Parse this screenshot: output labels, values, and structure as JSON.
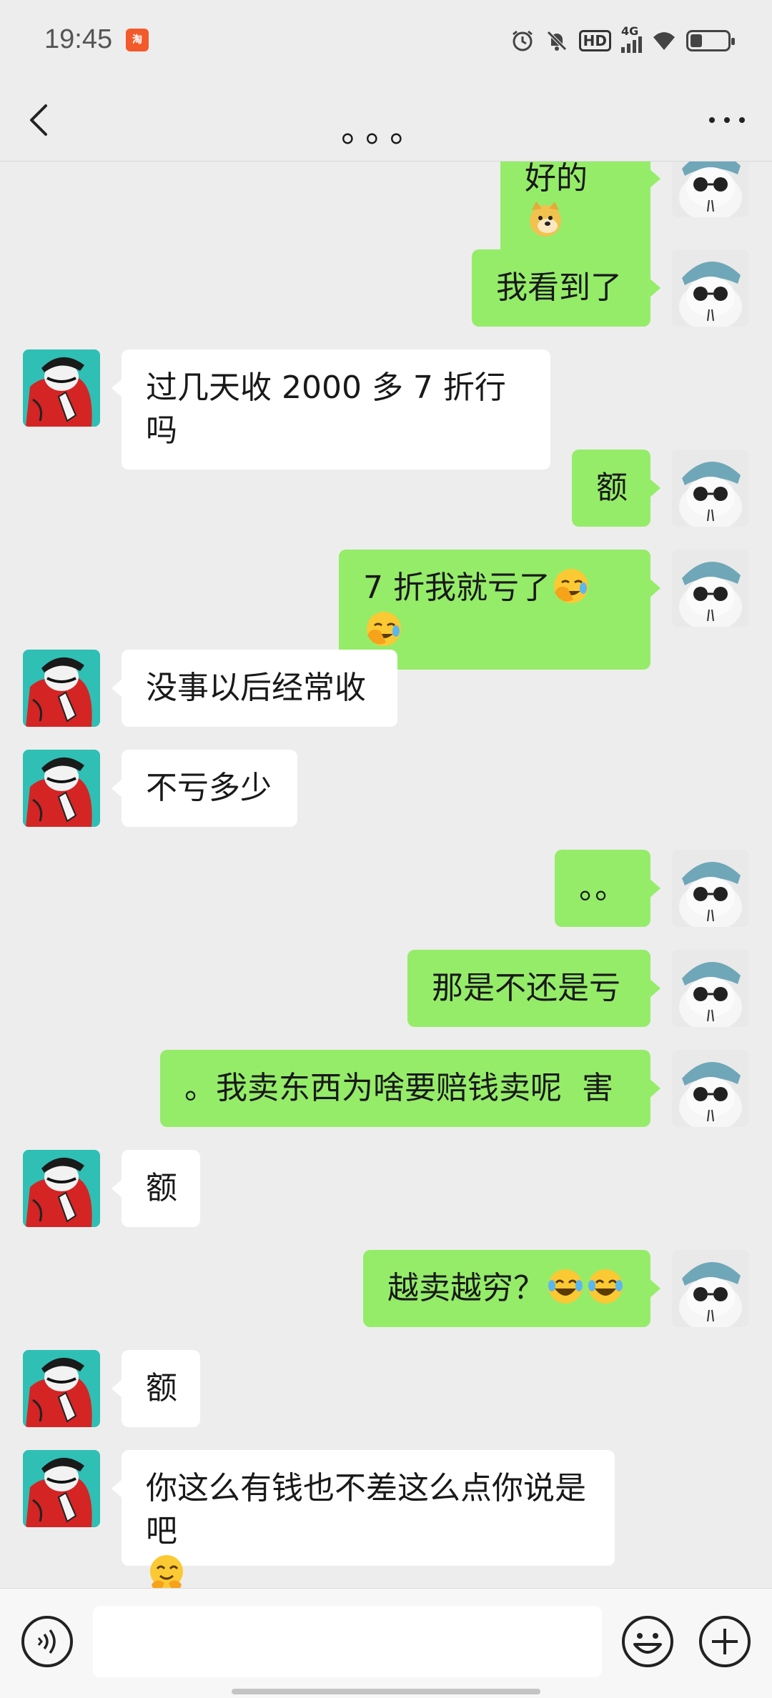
{
  "status_bar": {
    "time": "19:45",
    "hd_label": "HD",
    "network_label": "4G",
    "icons": [
      "alarm-icon",
      "mute-icon",
      "hd-icon",
      "signal-icon",
      "wifi-icon",
      "battery-icon"
    ]
  },
  "header": {
    "title": "。。。",
    "back_icon": "back-chevron-icon",
    "more_icon": "more-dots-icon"
  },
  "messages": [
    {
      "side": "right",
      "text": "好的",
      "emoji": "doge-emoji"
    },
    {
      "side": "right",
      "text": "我看到了"
    },
    {
      "side": "left",
      "text": "过几天收 2000 多 7 折行吗"
    },
    {
      "side": "right",
      "text": "额"
    },
    {
      "side": "right",
      "text": "7 折我就亏了",
      "emoji": "facepalm-emoji",
      "emoji_count": 2
    },
    {
      "side": "left",
      "text": "没事以后经常收"
    },
    {
      "side": "left",
      "text": "不亏多少"
    },
    {
      "side": "right",
      "text": "。。"
    },
    {
      "side": "right",
      "text": "那是不还是亏"
    },
    {
      "side": "right",
      "text": "。我卖东西为啥要赔钱卖呢  害"
    },
    {
      "side": "left",
      "text": "额"
    },
    {
      "side": "right",
      "text": "越卖越穷？",
      "emoji": "laugh-cry-emoji",
      "emoji_count": 2
    },
    {
      "side": "left",
      "text": "额"
    },
    {
      "side": "left",
      "text": "你这么有钱也不差这么点你说是吧",
      "emoji": "hug-emoji"
    }
  ],
  "colors": {
    "background": "#ededed",
    "self_bubble": "#95ec69",
    "other_bubble": "#ffffff"
  },
  "input_bar": {
    "placeholder": "",
    "voice_icon": "voice-icon",
    "emoji_icon": "emoji-icon",
    "plus_icon": "plus-icon"
  }
}
